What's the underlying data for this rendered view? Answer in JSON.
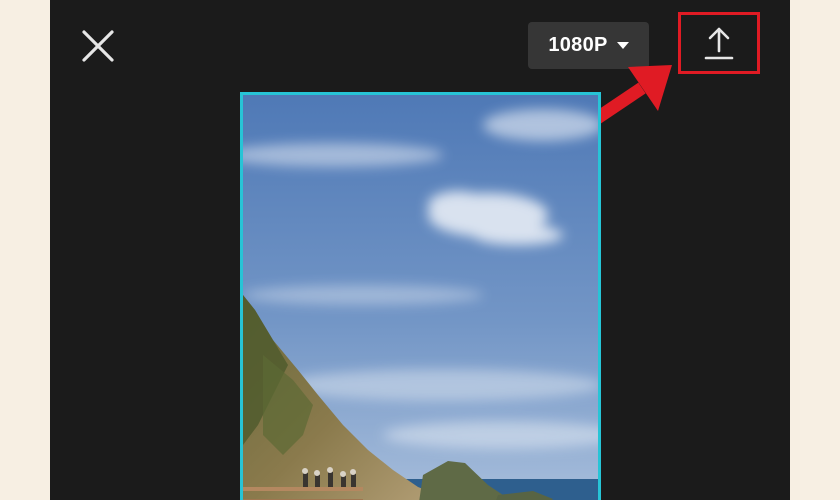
{
  "toolbar": {
    "close_icon": "close-icon",
    "resolution_label": "1080P",
    "resolution_caret_icon": "caret-down-icon",
    "export_icon": "upload-icon"
  },
  "annotation": {
    "highlight_color": "#e01b24",
    "pointer_icon": "arrow-icon"
  },
  "preview": {
    "selection_border_color": "#27c4d6"
  }
}
